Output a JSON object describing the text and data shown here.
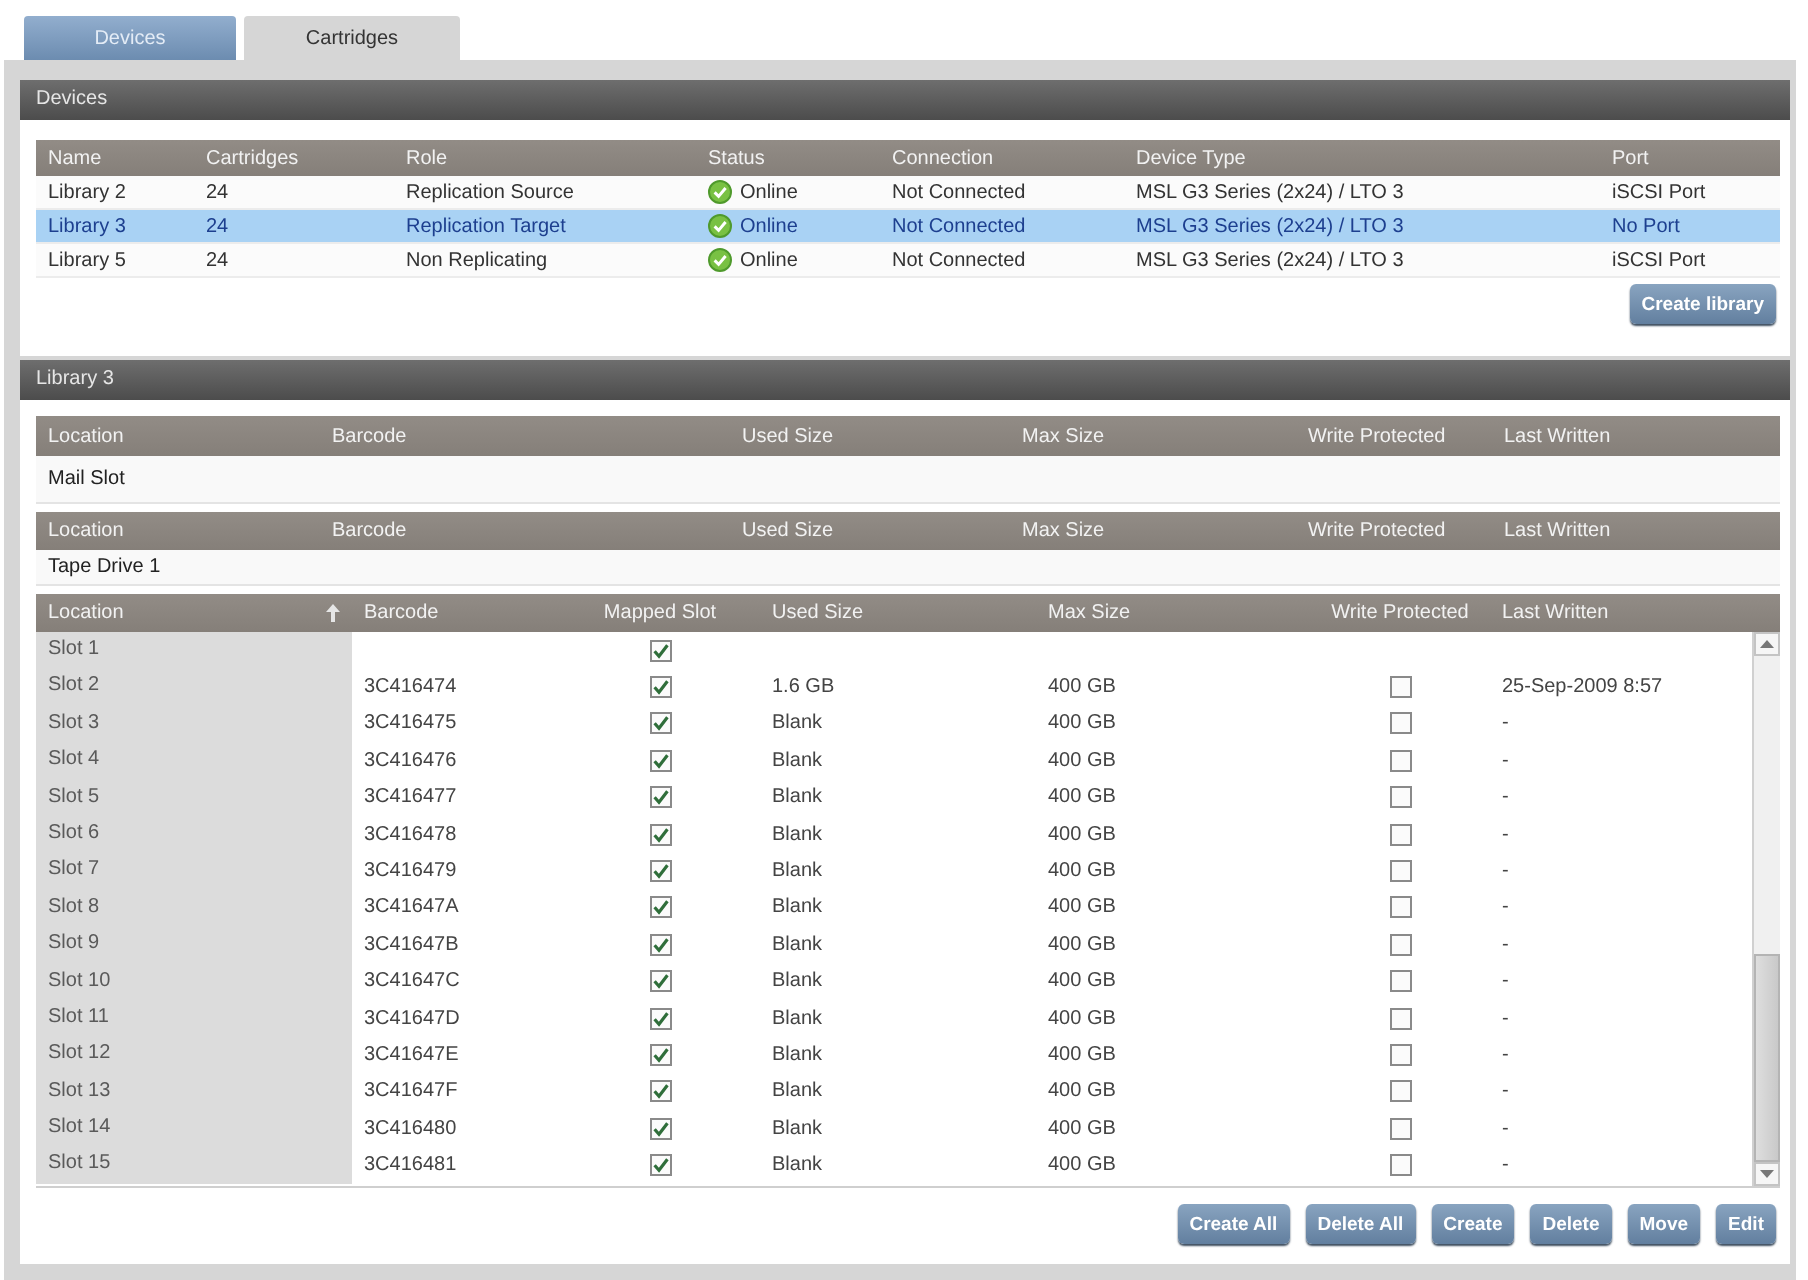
{
  "tabs": [
    {
      "label": "Devices",
      "selected": false
    },
    {
      "label": "Cartridges",
      "selected": true
    }
  ],
  "devices_section": {
    "title": "Devices",
    "table": {
      "columns": [
        "Name",
        "Cartridges",
        "Role",
        "Status",
        "Connection",
        "Device Type",
        "Port"
      ],
      "rows": [
        {
          "name": "Library 2",
          "cartridges": "24",
          "role": "Replication Source",
          "status": "Online",
          "connection": "Not Connected",
          "device_type": "MSL G3 Series (2x24) / LTO 3",
          "port": "iSCSI Port",
          "selected": false
        },
        {
          "name": "Library 3",
          "cartridges": "24",
          "role": "Replication Target",
          "status": "Online",
          "connection": "Not Connected",
          "device_type": "MSL G3 Series (2x24) / LTO 3",
          "port": "No Port",
          "selected": true
        },
        {
          "name": "Library 5",
          "cartridges": "24",
          "role": "Non Replicating",
          "status": "Online",
          "connection": "Not Connected",
          "device_type": "MSL G3 Series (2x24) / LTO 3",
          "port": "iSCSI Port",
          "selected": false
        }
      ]
    },
    "create_button": "Create library"
  },
  "library_section": {
    "title": "Library 3",
    "mail_slot_table": {
      "columns": [
        "Location",
        "Barcode",
        "Used Size",
        "Max Size",
        "Write Protected",
        "Last Written"
      ],
      "rows": [
        {
          "location": "Mail Slot"
        }
      ]
    },
    "tape_drive_table": {
      "columns": [
        "Location",
        "Barcode",
        "Used Size",
        "Max Size",
        "Write Protected",
        "Last Written"
      ],
      "rows": [
        {
          "location": "Tape Drive 1"
        }
      ]
    },
    "slot_table": {
      "columns": [
        {
          "label": "Location",
          "sorted": true
        },
        {
          "label": "Barcode",
          "sorted": false
        },
        {
          "label": "Mapped Slot",
          "sorted": false
        },
        {
          "label": "Used Size",
          "sorted": false
        },
        {
          "label": "Max Size",
          "sorted": false
        },
        {
          "label": "Write Protected",
          "sorted": false
        },
        {
          "label": "Last Written",
          "sorted": false
        }
      ],
      "rows": [
        {
          "location": "Slot 1",
          "mapped_slot_checked": true
        },
        {
          "location": "Slot 2",
          "barcode": "3C416474",
          "mapped_slot_checked": true,
          "used_size": "1.6 GB",
          "max_size": "400 GB",
          "write_protected_checked": false,
          "last_written": "25-Sep-2009 8:57"
        },
        {
          "location": "Slot 3",
          "barcode": "3C416475",
          "mapped_slot_checked": true,
          "used_size": "Blank",
          "max_size": "400 GB",
          "write_protected_checked": false,
          "last_written": "-"
        },
        {
          "location": "Slot 4",
          "barcode": "3C416476",
          "mapped_slot_checked": true,
          "used_size": "Blank",
          "max_size": "400 GB",
          "write_protected_checked": false,
          "last_written": "-"
        },
        {
          "location": "Slot 5",
          "barcode": "3C416477",
          "mapped_slot_checked": true,
          "used_size": "Blank",
          "max_size": "400 GB",
          "write_protected_checked": false,
          "last_written": "-"
        },
        {
          "location": "Slot 6",
          "barcode": "3C416478",
          "mapped_slot_checked": true,
          "used_size": "Blank",
          "max_size": "400 GB",
          "write_protected_checked": false,
          "last_written": "-"
        },
        {
          "location": "Slot 7",
          "barcode": "3C416479",
          "mapped_slot_checked": true,
          "used_size": "Blank",
          "max_size": "400 GB",
          "write_protected_checked": false,
          "last_written": "-"
        },
        {
          "location": "Slot 8",
          "barcode": "3C41647A",
          "mapped_slot_checked": true,
          "used_size": "Blank",
          "max_size": "400 GB",
          "write_protected_checked": false,
          "last_written": "-"
        },
        {
          "location": "Slot 9",
          "barcode": "3C41647B",
          "mapped_slot_checked": true,
          "used_size": "Blank",
          "max_size": "400 GB",
          "write_protected_checked": false,
          "last_written": "-"
        },
        {
          "location": "Slot 10",
          "barcode": "3C41647C",
          "mapped_slot_checked": true,
          "used_size": "Blank",
          "max_size": "400 GB",
          "write_protected_checked": false,
          "last_written": "-"
        },
        {
          "location": "Slot 11",
          "barcode": "3C41647D",
          "mapped_slot_checked": true,
          "used_size": "Blank",
          "max_size": "400 GB",
          "write_protected_checked": false,
          "last_written": "-"
        },
        {
          "location": "Slot 12",
          "barcode": "3C41647E",
          "mapped_slot_checked": true,
          "used_size": "Blank",
          "max_size": "400 GB",
          "write_protected_checked": false,
          "last_written": "-"
        },
        {
          "location": "Slot 13",
          "barcode": "3C41647F",
          "mapped_slot_checked": true,
          "used_size": "Blank",
          "max_size": "400 GB",
          "write_protected_checked": false,
          "last_written": "-"
        },
        {
          "location": "Slot 14",
          "barcode": "3C416480",
          "mapped_slot_checked": true,
          "used_size": "Blank",
          "max_size": "400 GB",
          "write_protected_checked": false,
          "last_written": "-"
        },
        {
          "location": "Slot 15",
          "barcode": "3C416481",
          "mapped_slot_checked": true,
          "used_size": "Blank",
          "max_size": "400 GB",
          "write_protected_checked": false,
          "last_written": "-"
        }
      ]
    },
    "buttons": [
      "Create All",
      "Delete All",
      "Create",
      "Delete",
      "Move",
      "Edit"
    ]
  }
}
